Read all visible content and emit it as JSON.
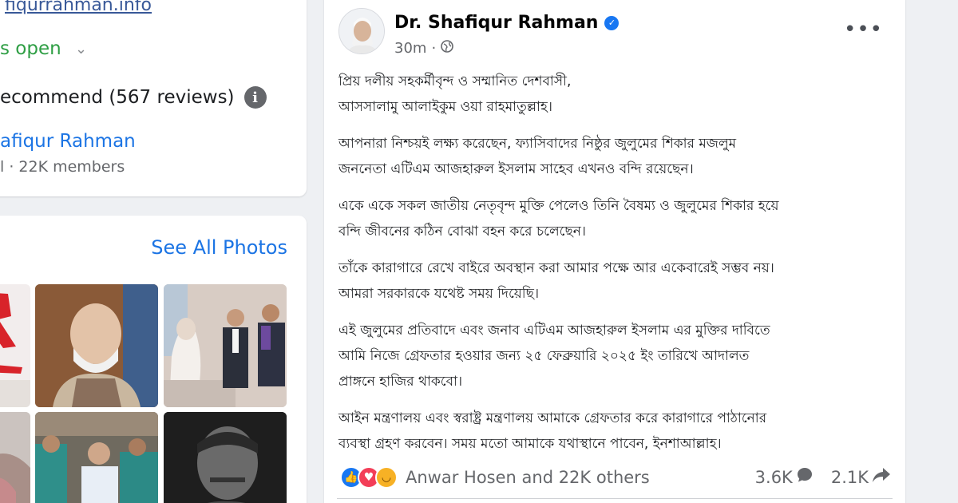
{
  "intro": {
    "website": "fiqurrahman.info",
    "hours": "s open",
    "reviews": "ecommend (567 reviews)",
    "group_name": "afiqur Rahman",
    "group_members": "l · 22K members"
  },
  "photos": {
    "see_all_label": "See All Photos"
  },
  "post": {
    "author": "Dr. Shafiqur Rahman",
    "time": "30m",
    "time_separator": "·",
    "more_label": "•••",
    "paragraphs": [
      {
        "line1": "প্রিয় দলীয় সহকর্মীবৃন্দ ও সম্মানিত দেশবাসী,",
        "line2": "আসসালামু আলাইকুম ওয়া রাহমাতুল্লাহ।"
      },
      {
        "line1": "আপনারা নিশ্চয়ই লক্ষ্য করেছেন, ফ্যাসিবাদের নিষ্ঠুর জুলুমের শিকার মজলুম",
        "line2": "জননেতা এটিএম আজহারুল ইসলাম সাহেব এখনও বন্দি রয়েছেন।"
      },
      {
        "line1": "একে একে সকল জাতীয় নেতৃবৃন্দ মুক্তি পেলেও তিনি বৈষম্য ও জুলুমের শিকার হয়ে",
        "line2": "বন্দি জীবনের কঠিন বোঝা বহন করে চলেছেন।"
      },
      {
        "line1": "তাঁকে কারাগারে রেখে বাইরে অবস্থান করা আমার পক্ষে আর একেবারেই সম্ভব নয়।",
        "line2": "আমরা সরকারকে যথেষ্ট সময় দিয়েছি।"
      },
      {
        "line1": "এই জুলুমের প্রতিবাদে এবং জনাব এটিএম আজহারুল ইসলাম এর মুক্তির দাবিতে",
        "line2": "আমি নিজে গ্রেফতার হওয়ার জন্য ২৫ ফেব্রুয়ারি ২০২৫ ইং তারিখে আদালত",
        "line3": "প্রাঙ্গনে হাজির থাকবো।"
      },
      {
        "line1": "আইন মন্ত্রণালয় এবং স্বরাষ্ট্র মন্ত্রণালয় আমাকে গ্রেফতার করে কারাগারে পাঠানোর",
        "line2": "ব্যবস্থা গ্রহণ করবেন। সময় মতো আমাকে যথাস্থানে পাবেন, ইনশাআল্লাহ।"
      }
    ],
    "reactions_text": "Anwar Hosen and 22K others",
    "comments_count": "3.6K",
    "shares_count": "2.1K"
  },
  "colors": {
    "link_blue": "#1b74e4",
    "open_green": "#2e9e44",
    "verified_blue": "#1877f2",
    "love_red": "#f33e58",
    "haha_yellow": "#f7b125"
  },
  "icons": {
    "hours_dropdown": "chevron-down-icon",
    "reviews_info": "info-icon",
    "verified": "verified-badge-icon",
    "audience": "globe-icon",
    "reactions": [
      "like-icon",
      "love-icon",
      "haha-icon"
    ],
    "comments": "comment-icon",
    "shares": "share-icon"
  }
}
